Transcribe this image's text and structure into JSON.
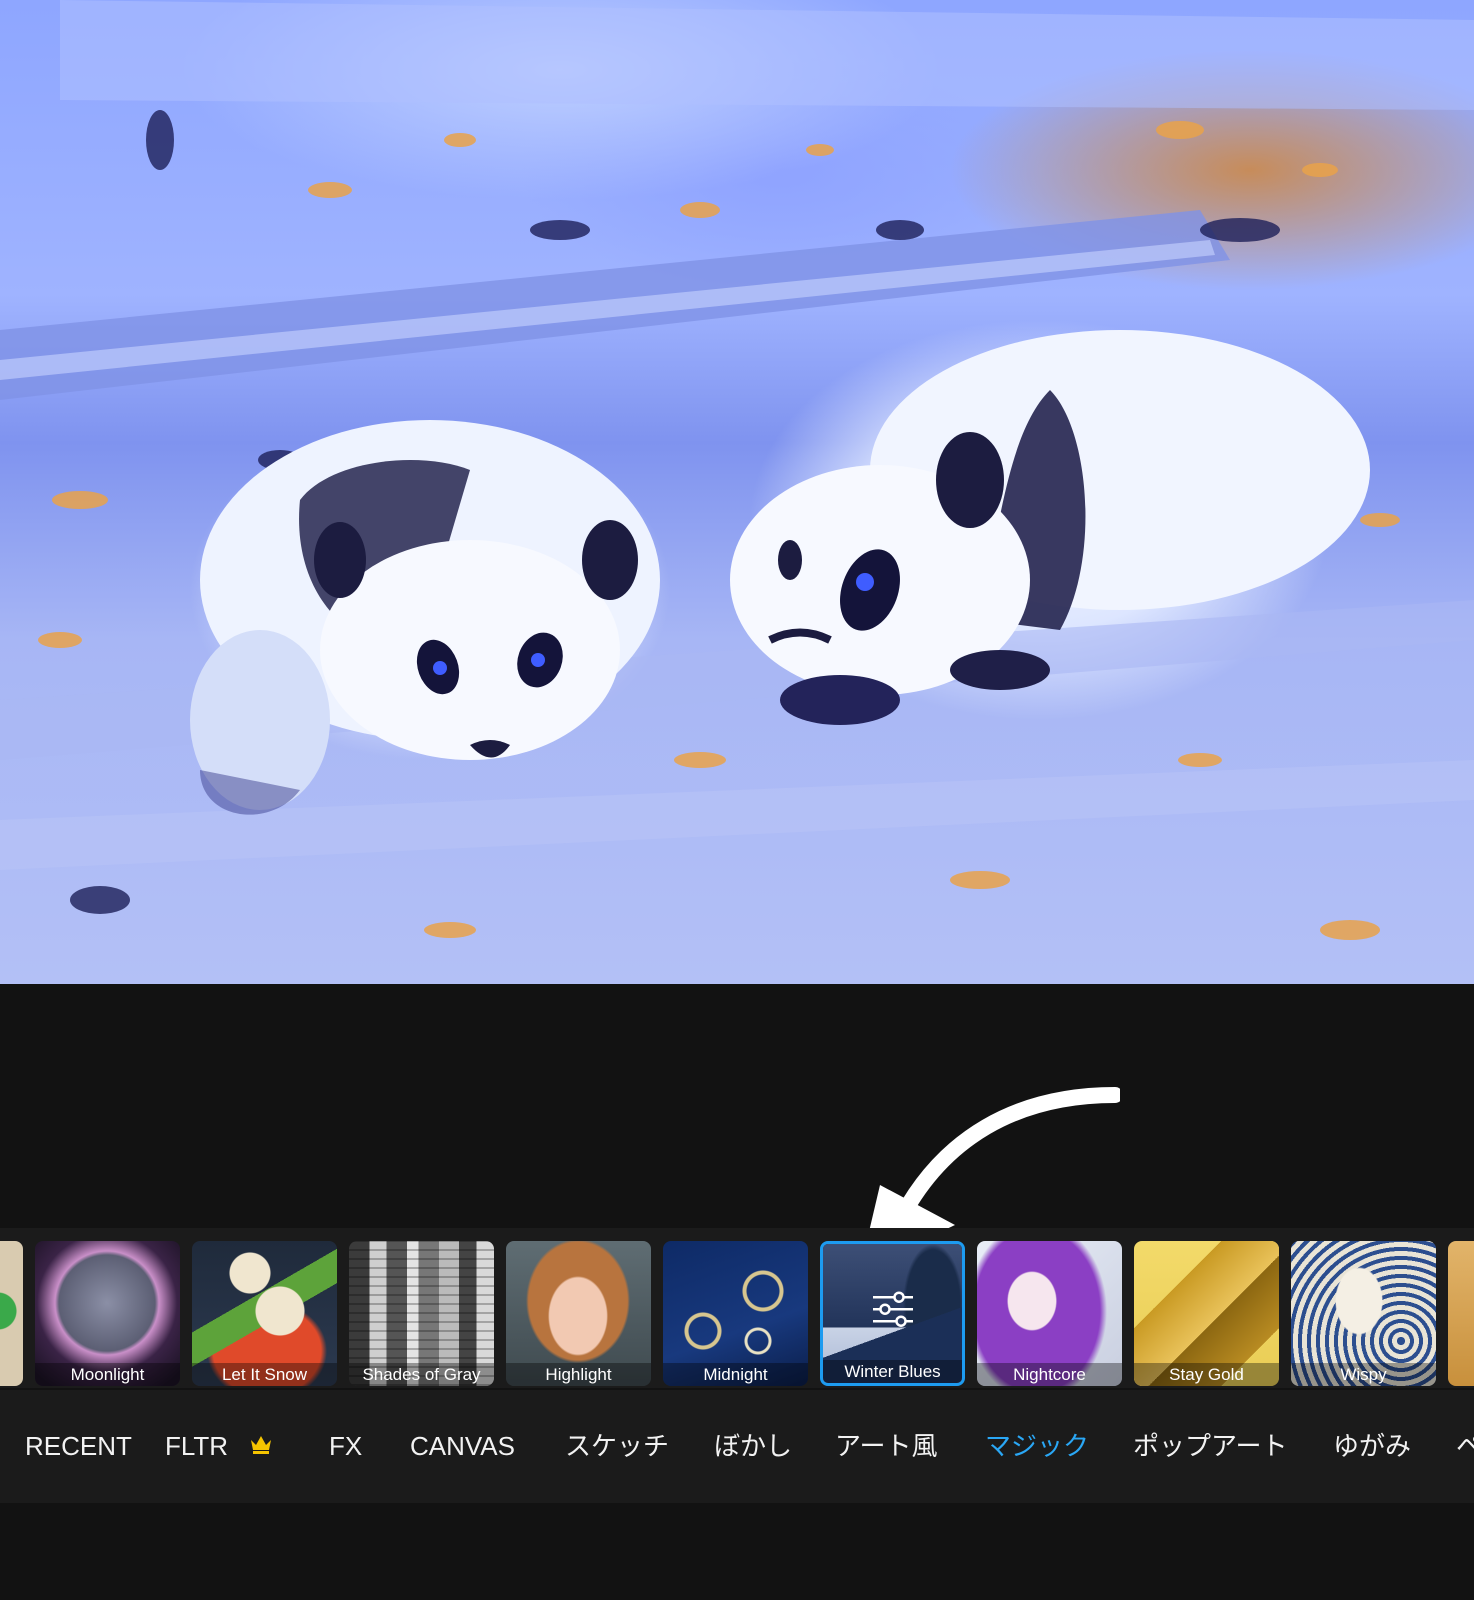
{
  "preview": {
    "alt_subject": "two panda cubs painted in Winter Blues style"
  },
  "filters": [
    {
      "label": "",
      "icon": "partial-thumb-icon"
    },
    {
      "label": "Moonlight"
    },
    {
      "label": "Let It Snow"
    },
    {
      "label": "Shades of Gray"
    },
    {
      "label": "Highlight"
    },
    {
      "label": "Midnight"
    },
    {
      "label": "Winter Blues",
      "selected": true,
      "icon": "adjust-sliders-icon"
    },
    {
      "label": "Nightcore"
    },
    {
      "label": "Stay Gold"
    },
    {
      "label": "Wispy"
    },
    {
      "label": "",
      "icon": "partial-thumb-icon"
    }
  ],
  "categories": [
    {
      "label": "RECENT"
    },
    {
      "label": "FLTR",
      "icon": "crown-icon"
    },
    {
      "label": "FX"
    },
    {
      "label": "CANVAS"
    },
    {
      "label": "スケッチ"
    },
    {
      "label": "ぼかし"
    },
    {
      "label": "アート風"
    },
    {
      "label": "マジック",
      "active": true
    },
    {
      "label": "ポップアート"
    },
    {
      "label": "ゆがみ"
    },
    {
      "label": "ペ"
    }
  ],
  "colors": {
    "accent": "#2aa7f5",
    "selected_border": "#1d9bf0",
    "crown": "#f5c400",
    "background": "#121212"
  }
}
